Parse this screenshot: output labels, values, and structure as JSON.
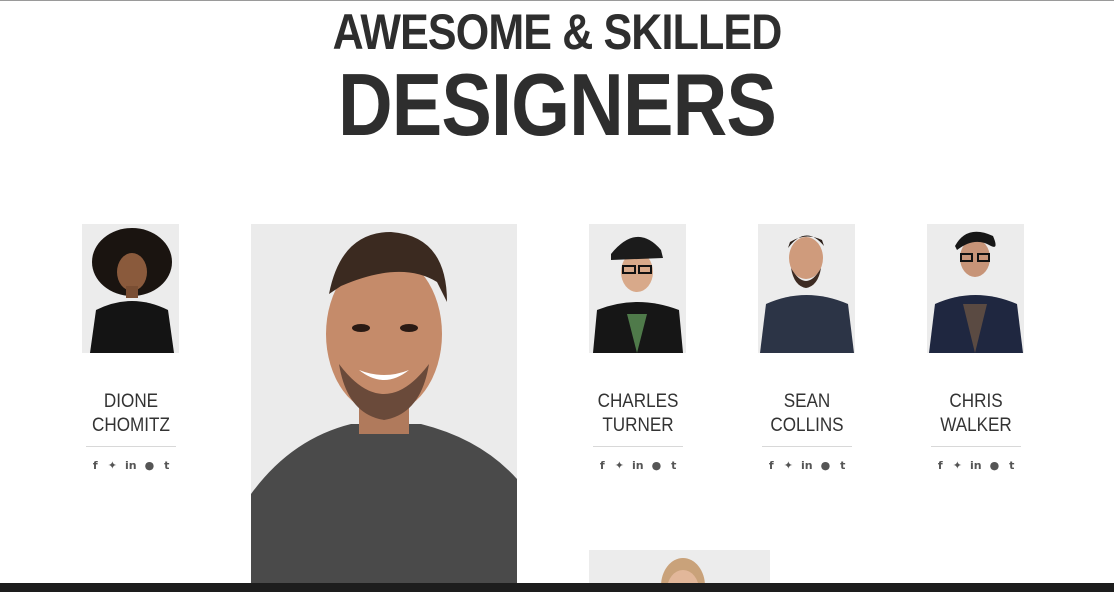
{
  "heading": {
    "line1": "AWESOME & SKILLED",
    "line2": "DESIGNERS"
  },
  "social_icons": [
    {
      "name": "facebook-icon",
      "glyph": "f"
    },
    {
      "name": "twitter-icon",
      "glyph": "🐦"
    },
    {
      "name": "linkedin-icon",
      "glyph": "in"
    },
    {
      "name": "pinterest-icon",
      "glyph": "℗"
    },
    {
      "name": "tumblr-icon",
      "glyph": "t"
    }
  ],
  "members": [
    {
      "first": "DIONE",
      "last": "CHOMITZ"
    },
    {
      "first": "CHARLES",
      "last": "TURNER"
    },
    {
      "first": "SEAN",
      "last": "COLLINS"
    },
    {
      "first": "CHRIS",
      "last": "WALKER"
    }
  ],
  "colors": {
    "heading": "#2e2e2e",
    "text": "#333333",
    "photo_bg": "#ebebeb",
    "bottom_bar": "#1d1d1d"
  }
}
